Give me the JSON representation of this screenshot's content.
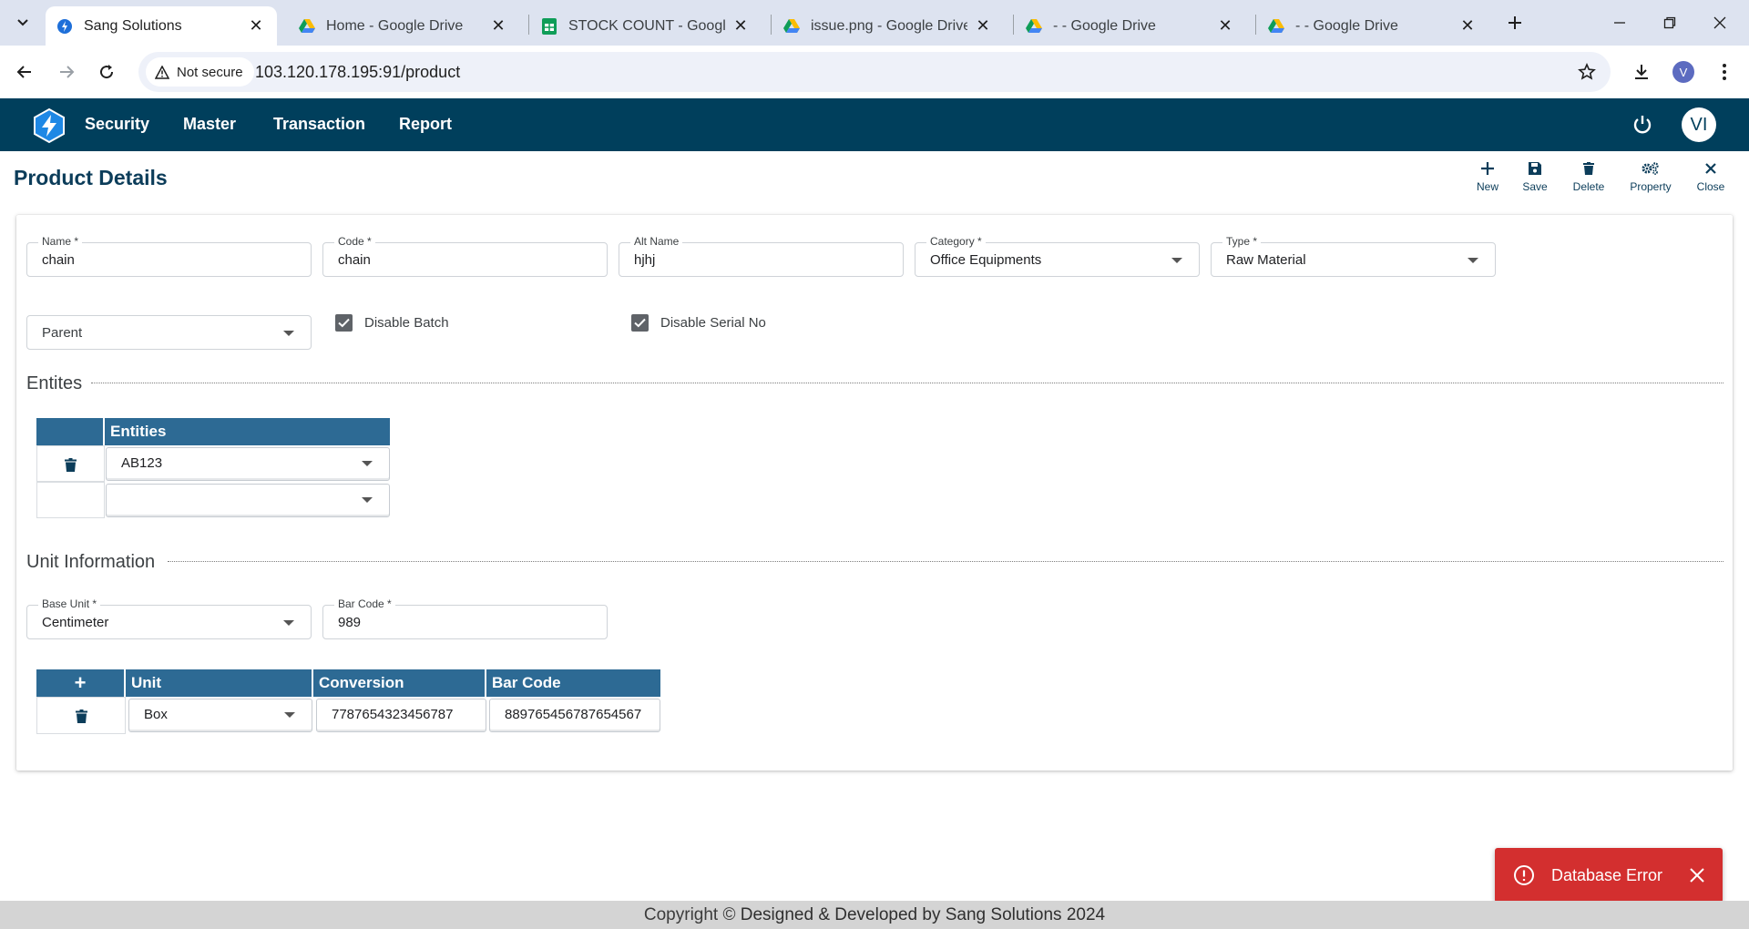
{
  "browser": {
    "tabs": [
      {
        "title": "Sang Solutions",
        "favicon": "sang-logo-icon",
        "active": true
      },
      {
        "title": "Home - Google Drive",
        "favicon": "google-drive-icon",
        "active": false
      },
      {
        "title": "STOCK COUNT - Google Sh",
        "favicon": "google-sheets-icon",
        "active": false
      },
      {
        "title": "issue.png - Google Drive",
        "favicon": "google-drive-icon",
        "active": false
      },
      {
        "title": "- - Google Drive",
        "favicon": "google-drive-icon",
        "active": false
      },
      {
        "title": "- - Google Drive",
        "favicon": "google-drive-icon",
        "active": false
      }
    ],
    "security_label": "Not secure",
    "url": "103.120.178.195:91/product",
    "profile_initial": "V"
  },
  "app": {
    "menu": [
      "Security",
      "Master",
      "Transaction",
      "Report"
    ],
    "user_initials": "VI"
  },
  "page": {
    "title": "Product Details",
    "actions": [
      {
        "label": "New",
        "icon": "plus-icon"
      },
      {
        "label": "Save",
        "icon": "save-icon"
      },
      {
        "label": "Delete",
        "icon": "trash-icon"
      },
      {
        "label": "Property",
        "icon": "gears-icon"
      },
      {
        "label": "Close",
        "icon": "close-icon"
      }
    ]
  },
  "form": {
    "name": {
      "label": "Name *",
      "value": "chain"
    },
    "code": {
      "label": "Code *",
      "value": "chain"
    },
    "alt_name": {
      "label": "Alt Name",
      "value": "hjhj"
    },
    "category": {
      "label": "Category *",
      "value": "Office Equipments"
    },
    "type": {
      "label": "Type *",
      "value": "Raw Material"
    },
    "parent": {
      "placeholder": "Parent"
    },
    "disable_batch": {
      "label": "Disable Batch",
      "checked": true
    },
    "disable_serial": {
      "label": "Disable Serial No",
      "checked": true
    }
  },
  "entities": {
    "section_title": "Entites",
    "header": "Entities",
    "rows": [
      {
        "value": "AB123"
      },
      {
        "value": ""
      }
    ]
  },
  "unit_info": {
    "section_title": "Unit Information",
    "base_unit": {
      "label": "Base Unit *",
      "value": "Centimeter"
    },
    "bar_code": {
      "label": "Bar Code *",
      "value": "989"
    },
    "table": {
      "add_symbol": "+",
      "headers": [
        "Unit",
        "Conversion",
        "Bar Code"
      ],
      "rows": [
        {
          "unit": "Box",
          "conversion": "7787654323456787",
          "bar_code": "889765456787654567"
        }
      ]
    }
  },
  "toast": {
    "message": "Database Error",
    "color": "#d32f2f"
  },
  "footer": {
    "prefix": "Copyright © ",
    "text": "Designed & Developed by Sang Solutions 2024"
  },
  "colors": {
    "header": "#003f5c",
    "table_header": "#2d6a94",
    "title": "#0c3d5a"
  }
}
